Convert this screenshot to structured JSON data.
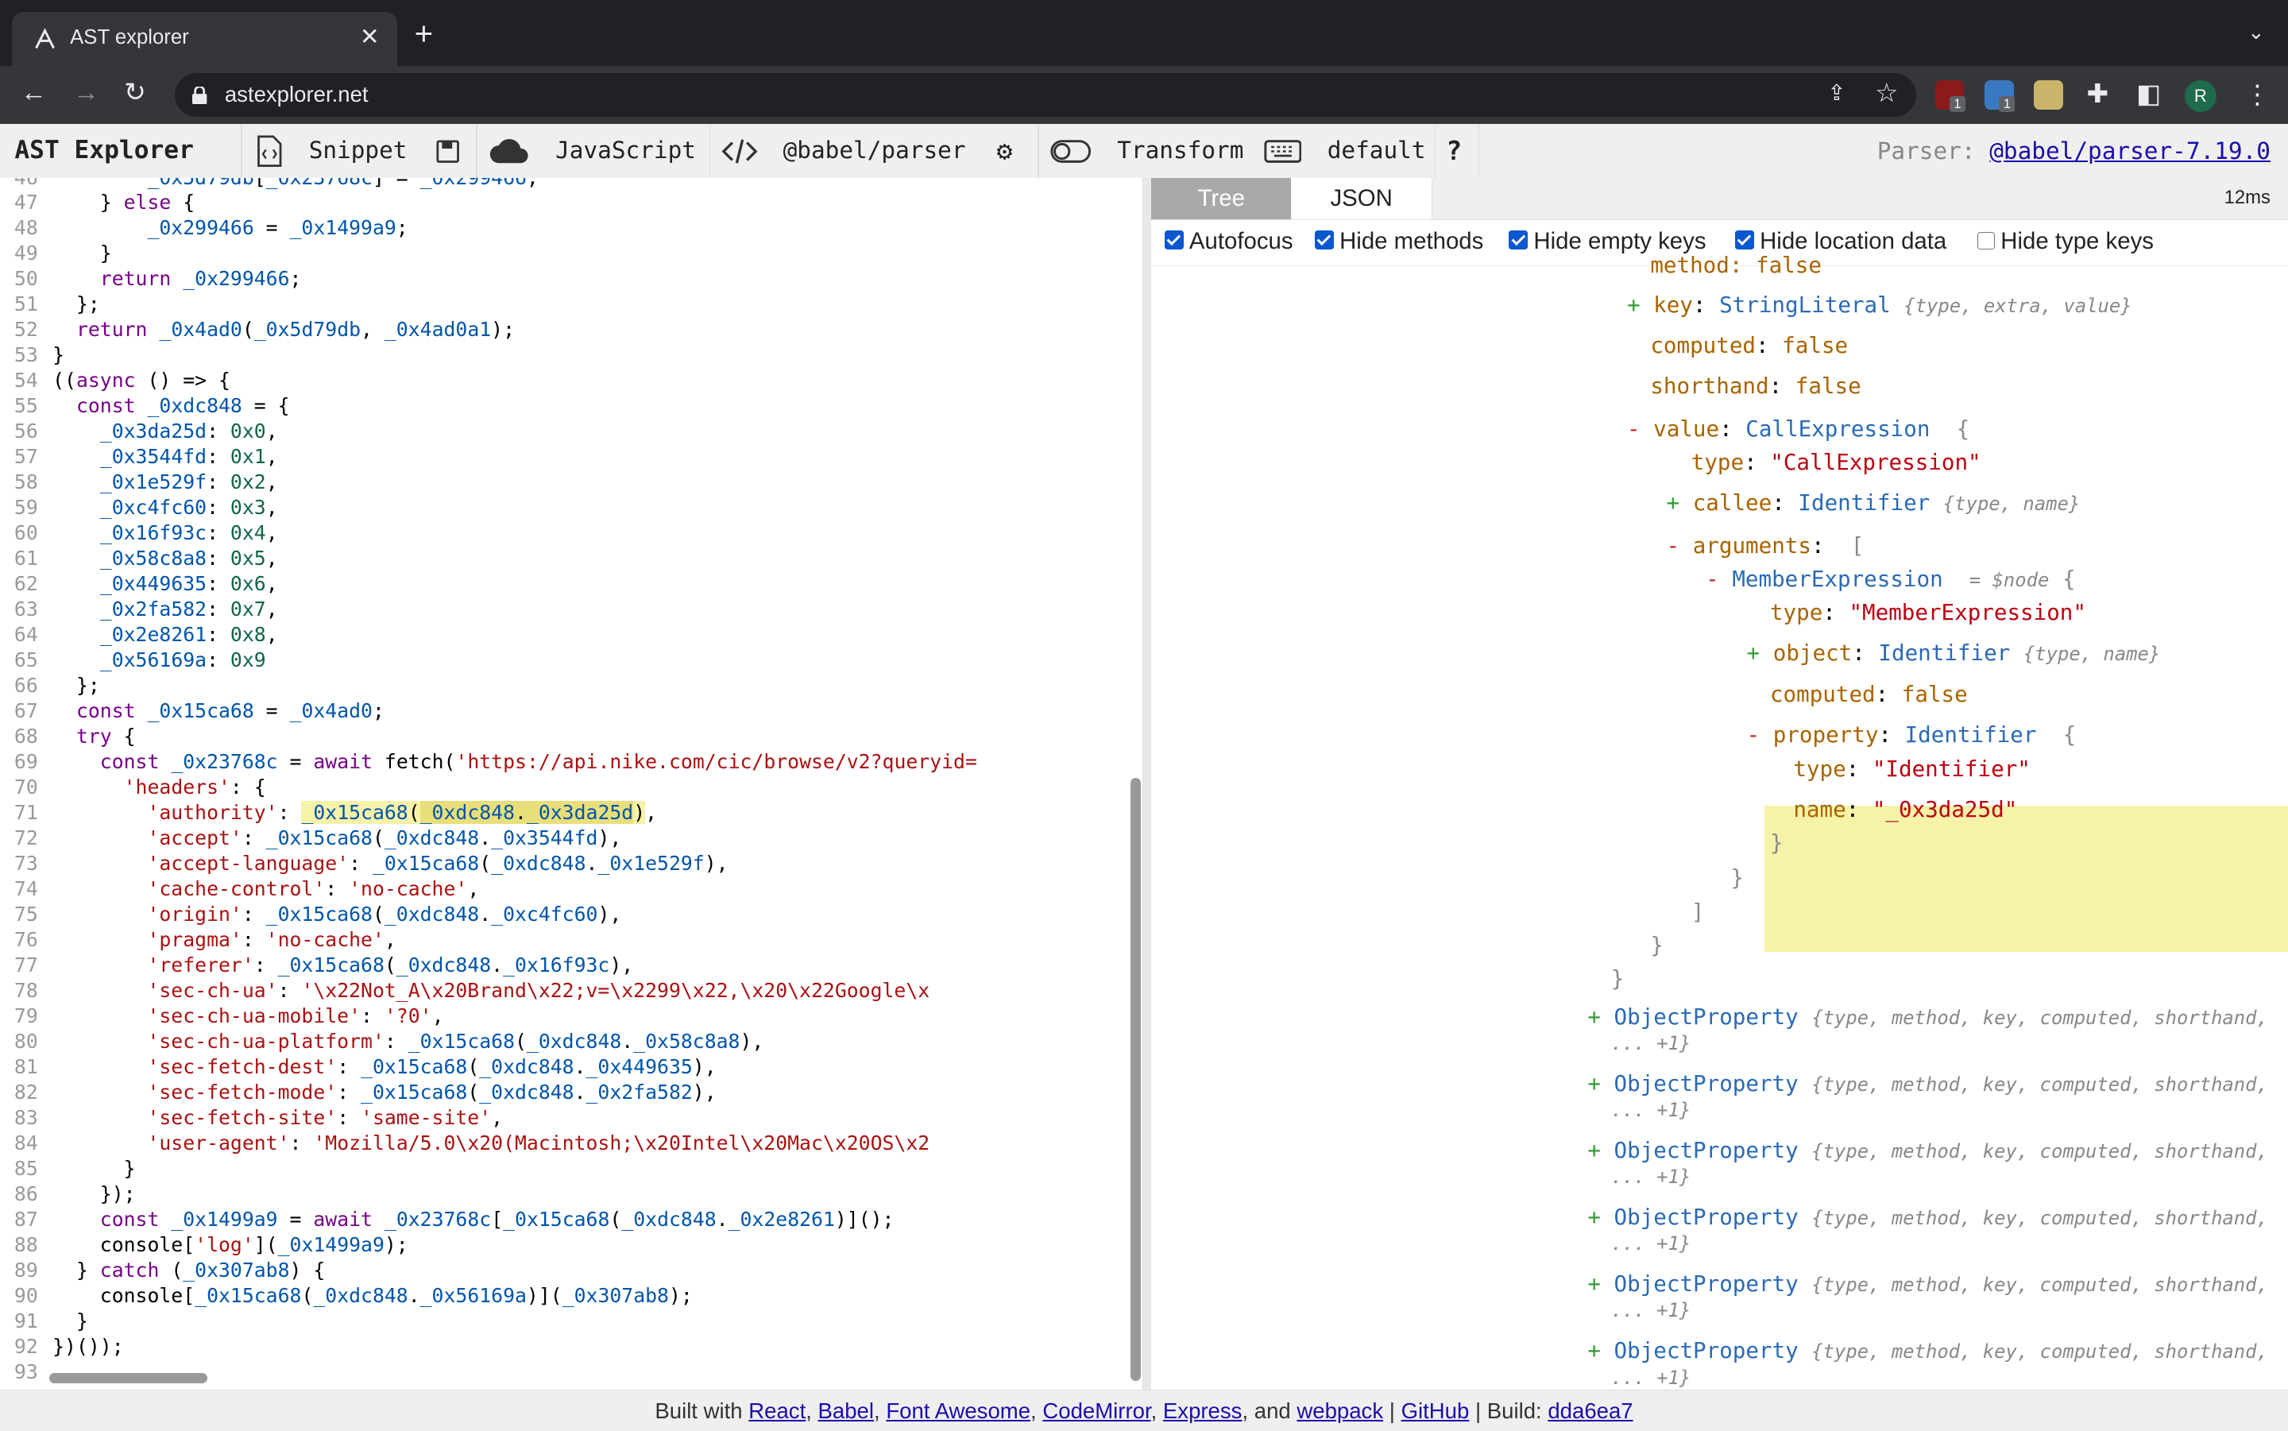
{
  "browser": {
    "tab_title": "AST explorer",
    "url": "astexplorer.net",
    "avatar_letter": "R",
    "ext_badges": [
      "1",
      "1"
    ]
  },
  "app": {
    "brand": "AST Explorer",
    "snippet": "Snippet",
    "language": "JavaScript",
    "parser": "@babel/parser",
    "transform": "Transform",
    "keymap": "default",
    "help": "?",
    "parser_label": "Parser:",
    "parser_version": "@babel/parser-7.19.0"
  },
  "output": {
    "tabs": [
      "Tree",
      "JSON"
    ],
    "timing": "12ms",
    "options": [
      {
        "label": "Autofocus",
        "checked": true
      },
      {
        "label": "Hide methods",
        "checked": true
      },
      {
        "label": "Hide empty keys",
        "checked": true
      },
      {
        "label": "Hide location data",
        "checked": true
      },
      {
        "label": "Hide type keys",
        "checked": false
      }
    ]
  },
  "code_lines": [
    {
      "n": "47",
      "text": "    } else {"
    },
    {
      "n": "48",
      "text": "        _0x299466 = _0x1499a9;"
    },
    {
      "n": "49",
      "text": "    }"
    },
    {
      "n": "50",
      "text": "    return _0x299466;"
    },
    {
      "n": "51",
      "text": "  };"
    },
    {
      "n": "52",
      "text": "  return _0x4ad0(_0x5d79db, _0x4ad0a1);"
    },
    {
      "n": "53",
      "text": "}"
    },
    {
      "n": "54",
      "text": "((async () => {"
    },
    {
      "n": "55",
      "text": "  const _0xdc848 = {"
    },
    {
      "n": "56",
      "text": "    _0x3da25d: 0x0,"
    },
    {
      "n": "57",
      "text": "    _0x3544fd: 0x1,"
    },
    {
      "n": "58",
      "text": "    _0x1e529f: 0x2,"
    },
    {
      "n": "59",
      "text": "    _0xc4fc60: 0x3,"
    },
    {
      "n": "60",
      "text": "    _0x16f93c: 0x4,"
    },
    {
      "n": "61",
      "text": "    _0x58c8a8: 0x5,"
    },
    {
      "n": "62",
      "text": "    _0x449635: 0x6,"
    },
    {
      "n": "63",
      "text": "    _0x2fa582: 0x7,"
    },
    {
      "n": "64",
      "text": "    _0x2e8261: 0x8,"
    },
    {
      "n": "65",
      "text": "    _0x56169a: 0x9"
    },
    {
      "n": "66",
      "text": "  };"
    },
    {
      "n": "67",
      "text": "  const _0x15ca68 = _0x4ad0;"
    },
    {
      "n": "68",
      "text": "  try {"
    },
    {
      "n": "69",
      "text": "    const _0x23768c = await fetch('https://api.nike.com/cic/browse/v2?queryid="
    },
    {
      "n": "70",
      "text": "      'headers': {"
    },
    {
      "n": "71",
      "text": "        'authority': _0x15ca68(_0xdc848._0x3da25d),"
    },
    {
      "n": "72",
      "text": "        'accept': _0x15ca68(_0xdc848._0x3544fd),"
    },
    {
      "n": "73",
      "text": "        'accept-language': _0x15ca68(_0xdc848._0x1e529f),"
    },
    {
      "n": "74",
      "text": "        'cache-control': 'no-cache',"
    },
    {
      "n": "75",
      "text": "        'origin': _0x15ca68(_0xdc848._0xc4fc60),"
    },
    {
      "n": "76",
      "text": "        'pragma': 'no-cache',"
    },
    {
      "n": "77",
      "text": "        'referer': _0x15ca68(_0xdc848._0x16f93c),"
    },
    {
      "n": "78",
      "text": "        'sec-ch-ua': '\\x22Not_A\\x20Brand\\x22;v=\\x2299\\x22,\\x20\\x22Google\\x"
    },
    {
      "n": "79",
      "text": "        'sec-ch-ua-mobile': '?0',"
    },
    {
      "n": "80",
      "text": "        'sec-ch-ua-platform': _0x15ca68(_0xdc848._0x58c8a8),"
    },
    {
      "n": "81",
      "text": "        'sec-fetch-dest': _0x15ca68(_0xdc848._0x449635),"
    },
    {
      "n": "82",
      "text": "        'sec-fetch-mode': _0x15ca68(_0xdc848._0x2fa582),"
    },
    {
      "n": "83",
      "text": "        'sec-fetch-site': 'same-site',"
    },
    {
      "n": "84",
      "text": "        'user-agent': 'Mozilla/5.0\\x20(Macintosh;\\x20Intel\\x20Mac\\x20OS\\x2"
    },
    {
      "n": "85",
      "text": "      }"
    },
    {
      "n": "86",
      "text": "    });"
    },
    {
      "n": "87",
      "text": "    const _0x1499a9 = await _0x23768c[_0x15ca68(_0xdc848._0x2e8261)]();"
    },
    {
      "n": "88",
      "text": "    console['log'](_0x1499a9);"
    },
    {
      "n": "89",
      "text": "  } catch (_0x307ab8) {"
    },
    {
      "n": "90",
      "text": "    console[_0x15ca68(_0xdc848._0x56169a)](_0x307ab8);"
    },
    {
      "n": "91",
      "text": "  }"
    },
    {
      "n": "92",
      "text": "})());"
    },
    {
      "n": "93",
      "text": ""
    }
  ],
  "tree": {
    "method_top": "method: false",
    "key_row": {
      "sign": "+",
      "key": "key",
      "type": "StringLiteral",
      "summary": "{type, extra, value}"
    },
    "computed_row": {
      "key": "computed",
      "val": "false"
    },
    "shorthand_row": {
      "key": "shorthand",
      "val": "false"
    },
    "value_row": {
      "sign": "-",
      "key": "value",
      "type": "CallExpression",
      "open": "{"
    },
    "value_type": {
      "key": "type",
      "val": "\"CallExpression\""
    },
    "callee_row": {
      "sign": "+",
      "key": "callee",
      "type": "Identifier",
      "summary": "{type, name}"
    },
    "arguments_row": {
      "sign": "-",
      "key": "arguments",
      "open": "["
    },
    "member_row": {
      "sign": "-",
      "type": "MemberExpression",
      "note": "= $node",
      "open": "{"
    },
    "member_type": {
      "key": "type",
      "val": "\"MemberExpression\""
    },
    "object_row": {
      "sign": "+",
      "key": "object",
      "type": "Identifier",
      "summary": "{type, name}"
    },
    "member_computed": {
      "key": "computed",
      "val": "false"
    },
    "property_row": {
      "sign": "-",
      "key": "property",
      "type": "Identifier",
      "open": "{"
    },
    "prop_type": {
      "key": "type",
      "val": "\"Identifier\""
    },
    "prop_name": {
      "key": "name",
      "val": "\"_0x3da25d\""
    },
    "close_brace": "}",
    "close_bracket": "]",
    "object_properties": {
      "sign": "+",
      "type": "ObjectProperty",
      "summary": "{type, method, key, computed, shorthand,",
      "more": "... +1}"
    }
  },
  "footer": {
    "built_with": "Built with",
    "links": [
      "React",
      "Babel",
      "Font Awesome",
      "CodeMirror",
      "Express",
      "webpack"
    ],
    "and": "and",
    "github": "GitHub",
    "build_label": "Build:",
    "build_hash": "dda6ea7"
  }
}
